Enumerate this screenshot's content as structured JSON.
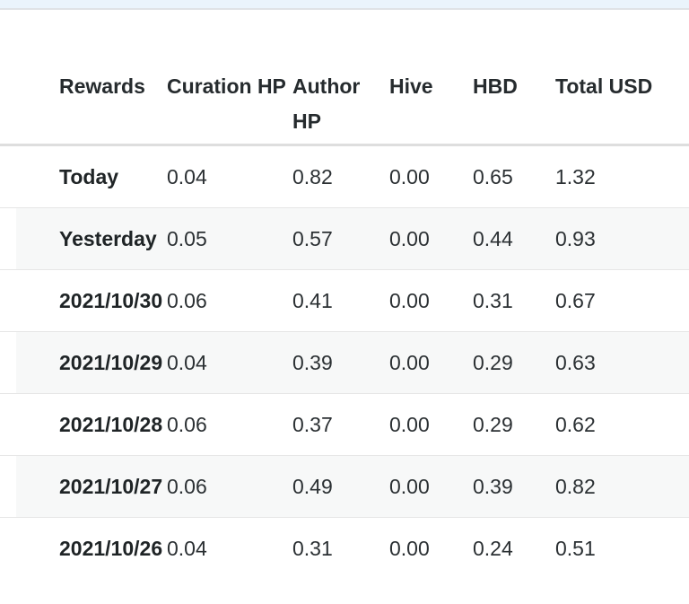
{
  "page": {
    "accent_strip_color": "#eaf4fc",
    "divider_color": "#dedede",
    "stripe_color": "#f7f8f8",
    "text_color": "#2b3033"
  },
  "table": {
    "headers": [
      "Rewards",
      "Curation HP",
      "Author HP",
      "Hive",
      "HBD",
      "Total USD"
    ],
    "rows": [
      {
        "label": "Today",
        "curation_hp": "0.04",
        "author_hp": "0.82",
        "hive": "0.00",
        "hbd": "0.65",
        "total_usd": "1.32"
      },
      {
        "label": "Yesterday",
        "curation_hp": "0.05",
        "author_hp": "0.57",
        "hive": "0.00",
        "hbd": "0.44",
        "total_usd": "0.93"
      },
      {
        "label": "2021/10/30",
        "curation_hp": "0.06",
        "author_hp": "0.41",
        "hive": "0.00",
        "hbd": "0.31",
        "total_usd": "0.67"
      },
      {
        "label": "2021/10/29",
        "curation_hp": "0.04",
        "author_hp": "0.39",
        "hive": "0.00",
        "hbd": "0.29",
        "total_usd": "0.63"
      },
      {
        "label": "2021/10/28",
        "curation_hp": "0.06",
        "author_hp": "0.37",
        "hive": "0.00",
        "hbd": "0.29",
        "total_usd": "0.62"
      },
      {
        "label": "2021/10/27",
        "curation_hp": "0.06",
        "author_hp": "0.49",
        "hive": "0.00",
        "hbd": "0.39",
        "total_usd": "0.82"
      },
      {
        "label": "2021/10/26",
        "curation_hp": "0.04",
        "author_hp": "0.31",
        "hive": "0.00",
        "hbd": "0.24",
        "total_usd": "0.51"
      }
    ]
  },
  "chart_data": {
    "type": "table",
    "title": "Rewards",
    "categories": [
      "Today",
      "Yesterday",
      "2021/10/30",
      "2021/10/29",
      "2021/10/28",
      "2021/10/27",
      "2021/10/26"
    ],
    "series": [
      {
        "name": "Curation HP",
        "values": [
          0.04,
          0.05,
          0.06,
          0.04,
          0.06,
          0.06,
          0.04
        ]
      },
      {
        "name": "Author HP",
        "values": [
          0.82,
          0.57,
          0.41,
          0.39,
          0.37,
          0.49,
          0.31
        ]
      },
      {
        "name": "Hive",
        "values": [
          0.0,
          0.0,
          0.0,
          0.0,
          0.0,
          0.0,
          0.0
        ]
      },
      {
        "name": "HBD",
        "values": [
          0.65,
          0.44,
          0.31,
          0.29,
          0.29,
          0.39,
          0.24
        ]
      },
      {
        "name": "Total USD",
        "values": [
          1.32,
          0.93,
          0.67,
          0.63,
          0.62,
          0.82,
          0.51
        ]
      }
    ]
  }
}
